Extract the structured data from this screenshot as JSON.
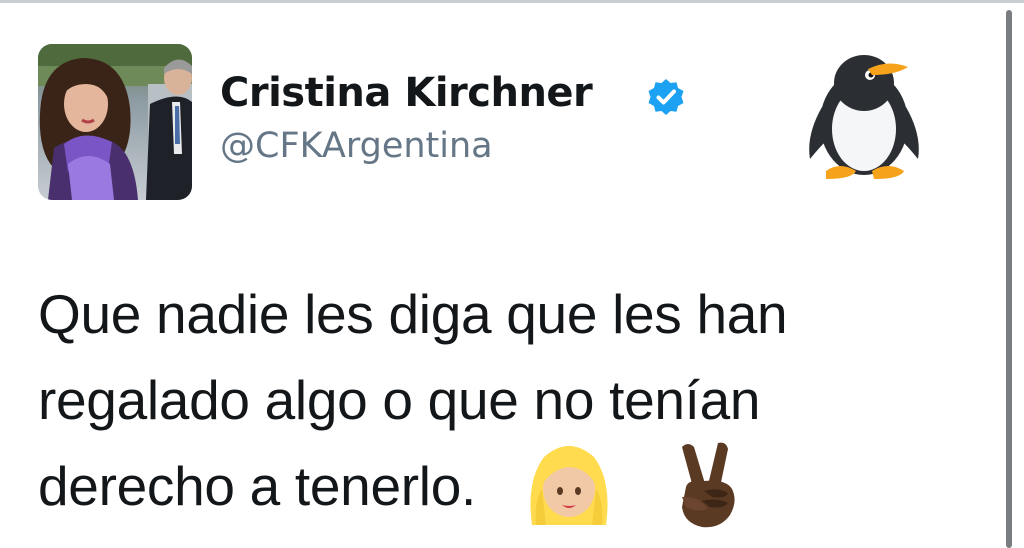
{
  "tweet": {
    "author": {
      "display_name": "Cristina Kirchner",
      "handle": "@CFKArgentina",
      "verified": true,
      "avatar_icon": "profile-photo"
    },
    "header_emoji_icon": "penguin-icon",
    "text_lines": [
      "Que nadie les diga que les han",
      "regalado algo o que no tenían",
      "derecho a tenerlo."
    ],
    "trailing_emoji_icons": [
      "woman-blond-hair-icon",
      "victory-hand-icon"
    ]
  },
  "colors": {
    "text_primary": "#14171a",
    "text_secondary": "#657786",
    "verified_blue": "#1da1f2",
    "top_border": "#c9ced3",
    "scrollbar": "#7a7d80"
  }
}
